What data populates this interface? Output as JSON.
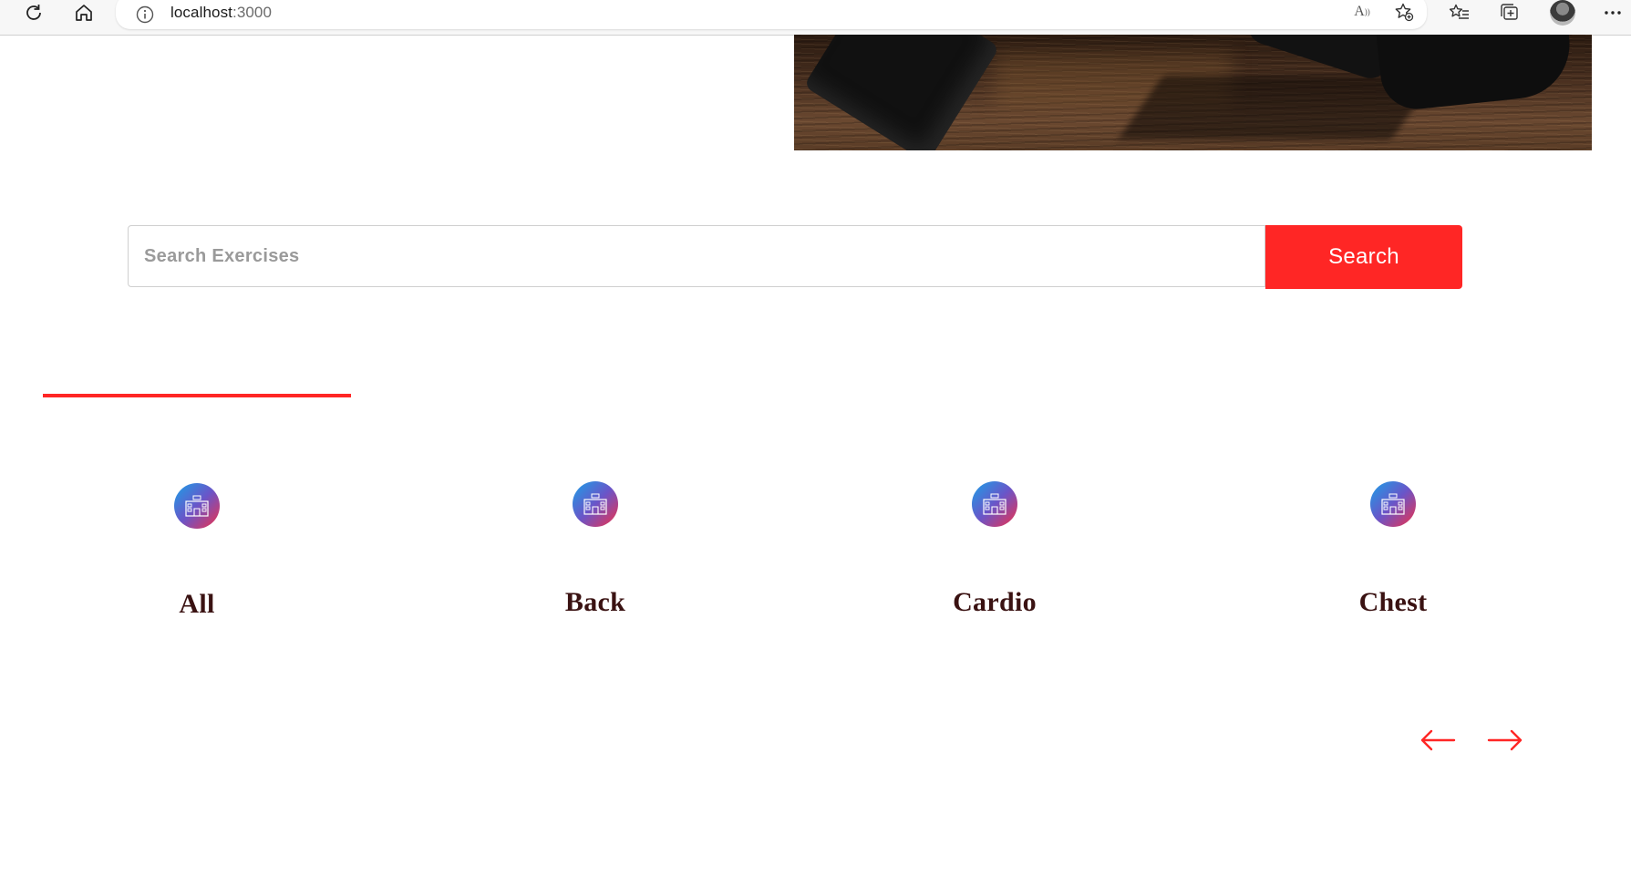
{
  "browser": {
    "url_host": "localhost",
    "url_port": ":3000",
    "icons": [
      "refresh-icon",
      "home-icon",
      "info-icon",
      "read-aloud-icon",
      "add-favorite-icon",
      "favorites-icon",
      "collections-icon",
      "profile-avatar",
      "more-icon"
    ]
  },
  "hero": {
    "image": "dumbbells-on-wooden-floor"
  },
  "search": {
    "placeholder": "Search Exercises",
    "value": "",
    "button_label": "Search"
  },
  "categories": {
    "items": [
      {
        "label": "All",
        "icon": "gym-icon"
      },
      {
        "label": "Back",
        "icon": "gym-icon"
      },
      {
        "label": "Cardio",
        "icon": "gym-icon"
      },
      {
        "label": "Chest",
        "icon": "gym-icon"
      }
    ],
    "selected": "All"
  },
  "pager": {
    "prev_icon": "left-arrow-icon",
    "next_icon": "right-arrow-icon"
  },
  "colors": {
    "accent": "#ff2625",
    "label": "#3a1212"
  }
}
